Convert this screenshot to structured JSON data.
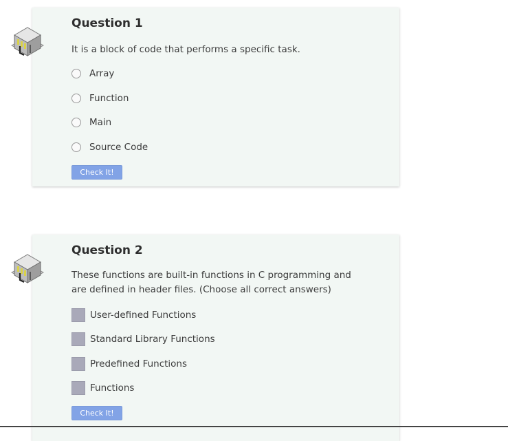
{
  "questions": [
    {
      "title": "Question 1",
      "text": "It is a block of code that performs a specific task.",
      "options": [
        "Array",
        "Function",
        "Main",
        "Source Code"
      ],
      "button_label": "Check It!",
      "icon": "building-icon"
    },
    {
      "title": "Question 2",
      "text": "These functions are built-in functions in C programming and are defined in header files. (Choose all correct answers)",
      "options": [
        "User-defined Functions",
        "Standard Library Functions",
        "Predefined Functions",
        "Functions"
      ],
      "button_label": "Check It!",
      "icon": "building-icon"
    }
  ],
  "colors": {
    "card_bg": "#f2f7f4",
    "button_bg": "#82a3e6",
    "checkbox_bg": "#a9a9b9"
  }
}
